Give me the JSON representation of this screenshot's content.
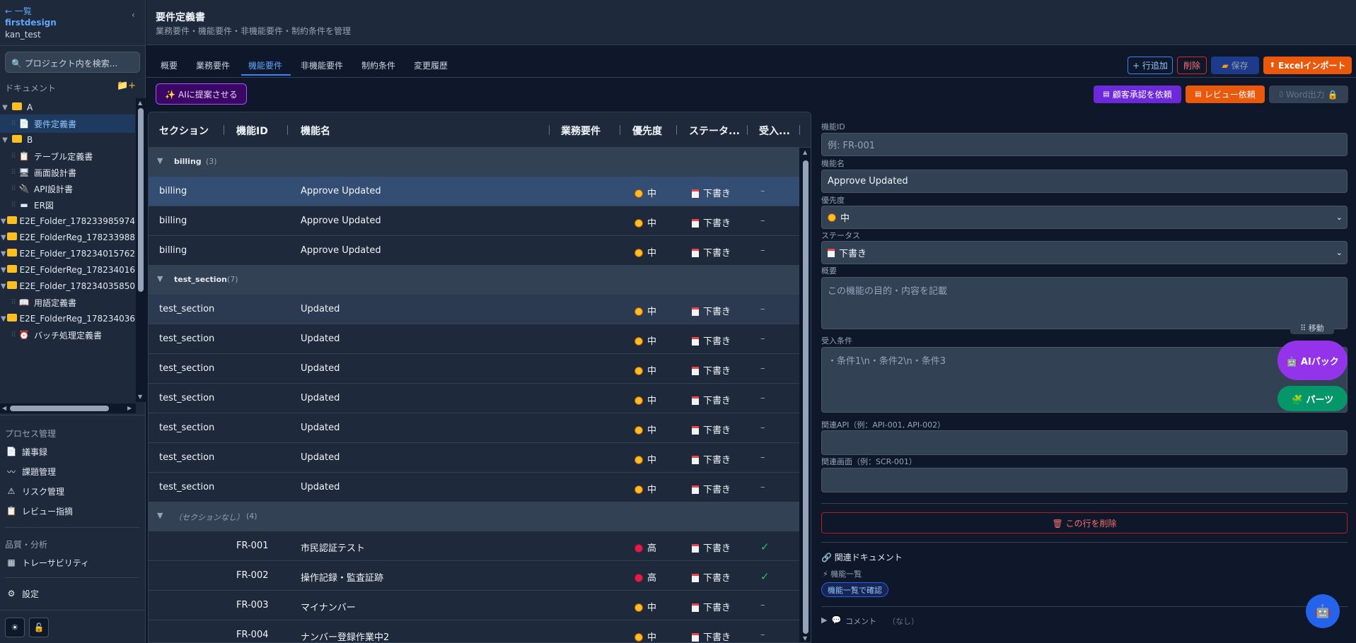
{
  "sidebar": {
    "back_label": "← 一覧",
    "project_name": "firstdesign",
    "project_id": "kan_test",
    "collapse_icon": "‹",
    "search_placeholder": "🔍 プロジェクト内を検索...",
    "documents_heading": "ドキュメント",
    "add_icon": "📁+",
    "tree": [
      {
        "label": "A",
        "type": "folder",
        "caret": "▼"
      },
      {
        "label": "要件定義書",
        "type": "doc",
        "icon": "📄",
        "selected": true
      },
      {
        "label": "B",
        "type": "folder",
        "caret": "▼"
      },
      {
        "label": "テーブル定義書",
        "type": "doc",
        "icon": "📋"
      },
      {
        "label": "画面設計書",
        "type": "doc",
        "icon": "🖥"
      },
      {
        "label": "API設計書",
        "type": "doc",
        "icon": "🔌"
      },
      {
        "label": "ER図",
        "type": "doc",
        "icon": "▬"
      },
      {
        "label": "E2E_Folder_178233985974",
        "type": "folder",
        "caret": "▼"
      },
      {
        "label": "E2E_FolderReg_178233988",
        "type": "folder",
        "caret": "▼"
      },
      {
        "label": "E2E_Folder_178234015762",
        "type": "folder",
        "caret": "▼"
      },
      {
        "label": "E2E_FolderReg_178234016",
        "type": "folder",
        "caret": "▼"
      },
      {
        "label": "E2E_Folder_178234035850",
        "type": "folder",
        "caret": "▼"
      },
      {
        "label": "用語定義書",
        "type": "doc",
        "icon": "📖"
      },
      {
        "label": "E2E_FolderReg_178234036",
        "type": "folder",
        "caret": "▼"
      },
      {
        "label": "バッチ処理定義書",
        "type": "doc",
        "icon": "⏰"
      }
    ],
    "process_heading": "プロセス管理",
    "process_items": [
      {
        "label": "議事録",
        "icon": "📄"
      },
      {
        "label": "課題管理",
        "icon": "〰"
      },
      {
        "label": "リスク管理",
        "icon": "⚠"
      },
      {
        "label": "レビュー指摘",
        "icon": "📋"
      }
    ],
    "quality_heading": "品質・分析",
    "quality_items": [
      {
        "label": "トレーサビリティ",
        "icon": "▦"
      }
    ],
    "settings_label": "設定",
    "settings_icon": "⚙",
    "theme_icon": "☀",
    "lock_icon": "🔓"
  },
  "header": {
    "title": "要件定義書",
    "subtitle": "業務要件・機能要件・非機能要件・制約条件を管理"
  },
  "tabs": [
    "概要",
    "業務要件",
    "機能要件",
    "非機能要件",
    "制約条件",
    "変更履歴"
  ],
  "toolbar": {
    "add_row": "+ 行追加",
    "delete": "削除",
    "save": "保存",
    "excel_import": "Excelインポート",
    "ai_suggest": "✨ AIに提案させる",
    "customer_approval": "顧客承認を依頼",
    "review_request": "レビュー依頼",
    "word_export": "Word出力 🔒"
  },
  "table": {
    "columns": [
      "セクション",
      "機能ID",
      "機能名",
      "業務要件",
      "優先度",
      "ステータ...",
      "受入..."
    ],
    "groups": [
      {
        "name": "billing",
        "count": "(3)",
        "rows": [
          {
            "section": "billing",
            "id": "",
            "name": "Approve Updated",
            "priority": "中",
            "level": "mid",
            "status": "下書き",
            "accept": "–"
          },
          {
            "section": "billing",
            "id": "",
            "name": "Approve Updated",
            "priority": "中",
            "level": "mid",
            "status": "下書き",
            "accept": "–"
          },
          {
            "section": "billing",
            "id": "",
            "name": "Approve Updated",
            "priority": "中",
            "level": "mid",
            "status": "下書き",
            "accept": "–"
          }
        ]
      },
      {
        "name": "test_section",
        "count": "(7)",
        "rows": [
          {
            "section": "test_section",
            "id": "",
            "name": "Updated",
            "priority": "中",
            "level": "mid",
            "status": "下書き",
            "accept": "–"
          },
          {
            "section": "test_section",
            "id": "",
            "name": "Updated",
            "priority": "中",
            "level": "mid",
            "status": "下書き",
            "accept": "–"
          },
          {
            "section": "test_section",
            "id": "",
            "name": "Updated",
            "priority": "中",
            "level": "mid",
            "status": "下書き",
            "accept": "–"
          },
          {
            "section": "test_section",
            "id": "",
            "name": "Updated",
            "priority": "中",
            "level": "mid",
            "status": "下書き",
            "accept": "–"
          },
          {
            "section": "test_section",
            "id": "",
            "name": "Updated",
            "priority": "中",
            "level": "mid",
            "status": "下書き",
            "accept": "–"
          },
          {
            "section": "test_section",
            "id": "",
            "name": "Updated",
            "priority": "中",
            "level": "mid",
            "status": "下書き",
            "accept": "–"
          },
          {
            "section": "test_section",
            "id": "",
            "name": "Updated",
            "priority": "中",
            "level": "mid",
            "status": "下書き",
            "accept": "–"
          }
        ]
      },
      {
        "name": "（セクションなし）",
        "count": "(4)",
        "rows": [
          {
            "section": "",
            "id": "FR-001",
            "name": "市民認証テスト",
            "priority": "高",
            "level": "high",
            "status": "下書き",
            "accept": "✓"
          },
          {
            "section": "",
            "id": "FR-002",
            "name": "操作記録・監査証跡",
            "priority": "高",
            "level": "high",
            "status": "下書き",
            "accept": "✓"
          },
          {
            "section": "",
            "id": "FR-003",
            "name": "マイナンバー",
            "priority": "中",
            "level": "mid",
            "status": "下書き",
            "accept": "–"
          },
          {
            "section": "",
            "id": "FR-004",
            "name": "ナンバー登録作業中2",
            "priority": "中",
            "level": "mid",
            "status": "下書き",
            "accept": "–"
          }
        ]
      }
    ]
  },
  "detail": {
    "id_label": "機能ID",
    "id_placeholder": "例: FR-001",
    "name_label": "機能名",
    "name_value": "Approve Updated",
    "priority_label": "優先度",
    "priority_value": "中",
    "status_label": "ステータス",
    "status_value": "下書き",
    "summary_label": "概要",
    "summary_placeholder": "この機能の目的・内容を記載",
    "move_label": "⠿ 移動",
    "accept_label": "受入条件",
    "accept_placeholder": "・条件1\\n・条件2\\n・条件3",
    "api_label": "関連API（例：API-001, API-002）",
    "screen_label": "関連画面（例：SCR-001）",
    "delete_row": "🗑 この行を削除",
    "related_docs": "🔗 関連ドキュメント",
    "feature_list": "⚡ 機能一覧",
    "confirm_badge": "機能一覧で確認",
    "comments": "コメント",
    "comments_none": "（なし）",
    "ai_pack": "🤖 AIパック",
    "parts": "🧩 パーツ"
  },
  "colors": {
    "accent": "#3b82f6",
    "orange": "#ea580c",
    "violet": "#6d28d9",
    "green": "#059669",
    "purple": "#9333ea"
  }
}
